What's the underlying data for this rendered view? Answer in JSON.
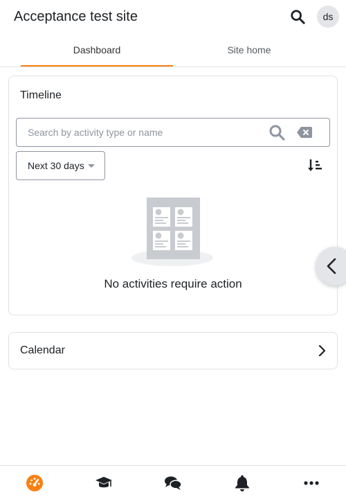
{
  "header": {
    "site_title": "Acceptance test site",
    "avatar_initials": "ds"
  },
  "tabs": [
    {
      "label": "Dashboard",
      "active": true
    },
    {
      "label": "Site home",
      "active": false
    }
  ],
  "timeline": {
    "title": "Timeline",
    "search_placeholder": "Search by activity type or name",
    "search_value": "",
    "filter_label": "Next 30 days",
    "empty_message": "No activities require action"
  },
  "calendar": {
    "title": "Calendar"
  },
  "bottom_nav": {
    "items": [
      "dashboard-icon",
      "courses-icon",
      "messages-icon",
      "notifications-icon",
      "more-icon"
    ],
    "active": "dashboard-icon"
  },
  "colors": {
    "accent": "#f98012",
    "text": "#1d2125",
    "muted": "#8f959e",
    "border": "#dee2e6",
    "illustration": "#c8cbcf"
  }
}
